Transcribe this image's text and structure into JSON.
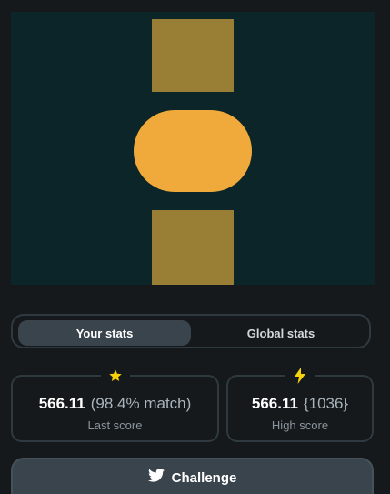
{
  "tabs": {
    "your_stats": "Your stats",
    "global_stats": "Global stats"
  },
  "last_score": {
    "value": "566.11",
    "detail": "(98.4% match)",
    "label": "Last score",
    "icon": "star-icon"
  },
  "high_score": {
    "value": "566.11",
    "detail": "{1036}",
    "label": "High score",
    "icon": "lightning-icon"
  },
  "challenge": {
    "label": "Challenge",
    "icon": "twitter-icon"
  },
  "colors": {
    "stage_bg": "#0c2529",
    "block": "#997f35",
    "pill": "#f0aa3c",
    "accent_icon": "#f5d20a"
  }
}
